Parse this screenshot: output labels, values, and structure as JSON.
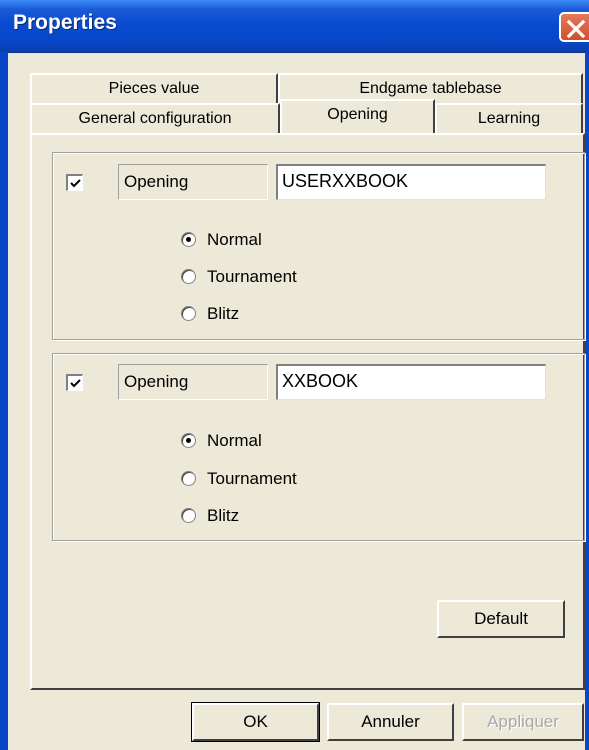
{
  "window": {
    "title": "Properties"
  },
  "tabs": {
    "row_back": [
      "Pieces value",
      "Endgame tablebase"
    ],
    "row_front": [
      "General configuration",
      "Opening",
      "Learning"
    ],
    "active": "Opening"
  },
  "books": [
    {
      "checked": true,
      "label": "Opening",
      "value": "USERXXBOOK",
      "radios": [
        {
          "label": "Normal",
          "checked": true
        },
        {
          "label": "Tournament",
          "checked": false
        },
        {
          "label": "Blitz",
          "checked": false
        }
      ]
    },
    {
      "checked": true,
      "label": "Opening",
      "value": "XXBOOK",
      "radios": [
        {
          "label": "Normal",
          "checked": true
        },
        {
          "label": "Tournament",
          "checked": false
        },
        {
          "label": "Blitz",
          "checked": false
        }
      ]
    }
  ],
  "buttons": {
    "default_label": "Default",
    "ok_label": "OK",
    "cancel_label": "Annuler",
    "apply_label": "Appliquer",
    "apply_enabled": false
  }
}
